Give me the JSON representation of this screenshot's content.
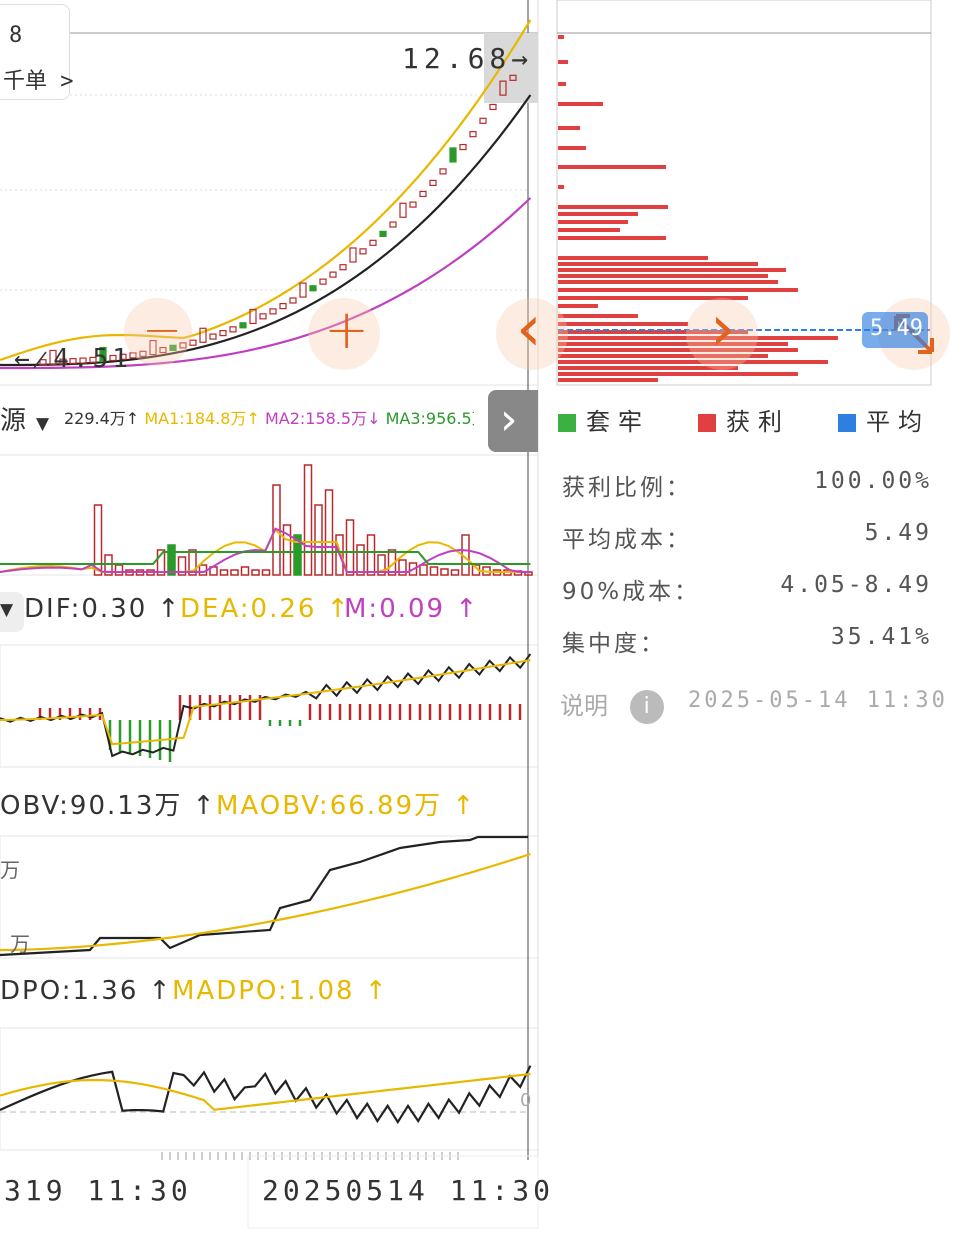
{
  "main": {
    "top_left_number": "8",
    "top_left_menu": "千单",
    "high_label": "12.68→",
    "low_label": "← 4.51",
    "zoom_out": "−",
    "zoom_in": "+",
    "prev_arrow": "‹",
    "next_arrow": "›"
  },
  "volume": {
    "dropdown": "源",
    "text": "229.4万↑",
    "ma1": "MA1:184.8万↑",
    "ma2": "MA2:158.5万↓",
    "ma3": "MA3:956.5万↑",
    "colors": {
      "ma1": "#e8b800",
      "ma2": "#c040c0",
      "ma3": "#2a9a2a"
    }
  },
  "macd": {
    "dif": "DIF:0.30 ↑",
    "dea": "DEA:0.26 ↑",
    "m": "M:0.09 ↑"
  },
  "obv": {
    "obv": "OBV:90.13万 ↑",
    "maobv": "MAOBV:66.89万 ↑",
    "axis_top": "万",
    "axis_bottom": "万"
  },
  "dpo": {
    "dpo": "DPO:1.36 ↑",
    "madpo": "MADPO:1.08 ↑",
    "zero": "0"
  },
  "time_axis": {
    "left": "319 11:30",
    "right": "20250514 11:30"
  },
  "chip": {
    "avg_cost_tag": "5.49",
    "legend": [
      {
        "label": "套牢",
        "color": "#3cb043"
      },
      {
        "label": "获利",
        "color": "#e04040"
      },
      {
        "label": "平均",
        "color": "#2f7fe0"
      }
    ],
    "stats": [
      {
        "label": "获利比例：",
        "value": "100.00%"
      },
      {
        "label": "平均成本：",
        "value": "5.49"
      },
      {
        "label": "90%成本：",
        "value": "4.05-8.49"
      },
      {
        "label": "集中度：",
        "value": "35.41%"
      }
    ],
    "note_label": "说明",
    "timestamp": "2025-05-14 11:30"
  },
  "colors": {
    "up": "#b8282c",
    "down": "#2a9a2a",
    "ma_yellow": "#e8b800",
    "ma_black": "#222222",
    "ma_magenta": "#c040c0",
    "chip_red": "#e04040",
    "accent_orange": "#e0641e"
  }
}
